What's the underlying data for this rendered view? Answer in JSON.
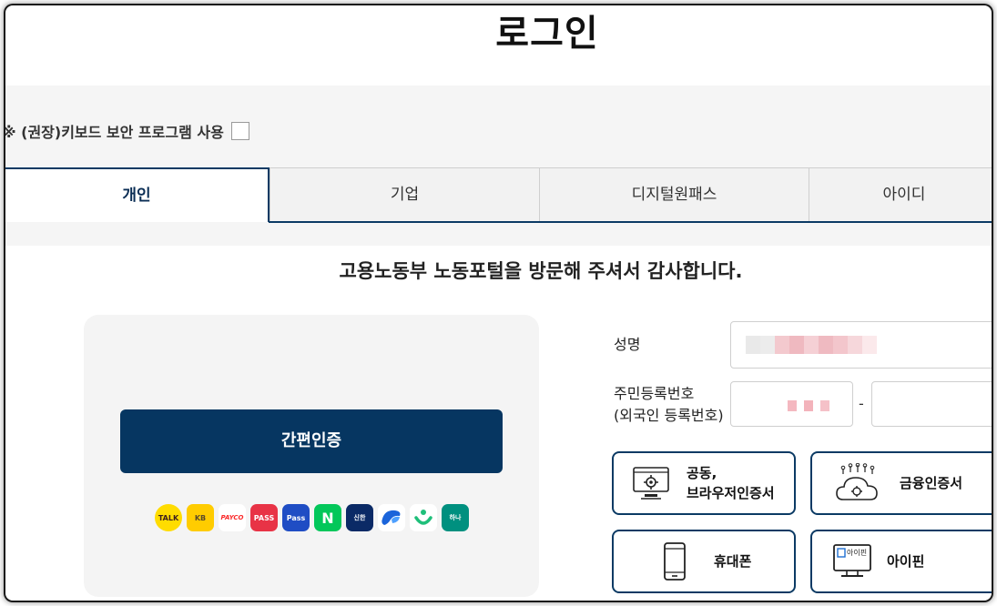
{
  "page": {
    "title": "로그인"
  },
  "security": {
    "label": "※ (권장)키보드 보안 프로그램 사용"
  },
  "tabs": [
    {
      "label": "개인",
      "active": true
    },
    {
      "label": "기업",
      "active": false
    },
    {
      "label": "디지털원패스",
      "active": false
    },
    {
      "label": "아이디",
      "active": false
    }
  ],
  "welcome": "고용노동부 노동포털을 방문해 주셔서 감사합니다.",
  "easy_auth": {
    "button_label": "간편인증",
    "providers": [
      {
        "icon": "kakaotalk-icon",
        "text": "TALK",
        "color": "#ffdc00"
      },
      {
        "icon": "kb-icon",
        "text": "KB",
        "color": "#ffcc00"
      },
      {
        "icon": "payco-icon",
        "text": "PAYCO",
        "color": "#fa2828"
      },
      {
        "icon": "pass-icon",
        "text": "PASS",
        "color": "#e83346"
      },
      {
        "icon": "samsung-pass-icon",
        "text": "Pass",
        "color": "#1f4dc4"
      },
      {
        "icon": "naver-icon",
        "text": "N",
        "color": "#03c75a"
      },
      {
        "icon": "shinhan-icon",
        "text": "신한",
        "color": "#0b2a66"
      },
      {
        "icon": "toss-icon",
        "text": "",
        "color": "#ffffff"
      },
      {
        "icon": "banksalad-icon",
        "text": "",
        "color": "#ffffff"
      },
      {
        "icon": "hana-icon",
        "text": "하나",
        "color": "#00907f"
      }
    ]
  },
  "form": {
    "name_label": "성명",
    "rrn_label_1": "주민등록번호",
    "rrn_label_2": "(외국인 등록번호)",
    "dash": "-"
  },
  "auth_buttons": {
    "joint_cert_line1": "공동,",
    "joint_cert_line2": "브라우저인증서",
    "financial_cert": "금융인증서",
    "mobile": "휴대폰",
    "ipin": "아이핀",
    "ipin_screen_text": "아이핀"
  },
  "colors": {
    "primary": "#063661",
    "tab_border": "#0b3a64"
  }
}
